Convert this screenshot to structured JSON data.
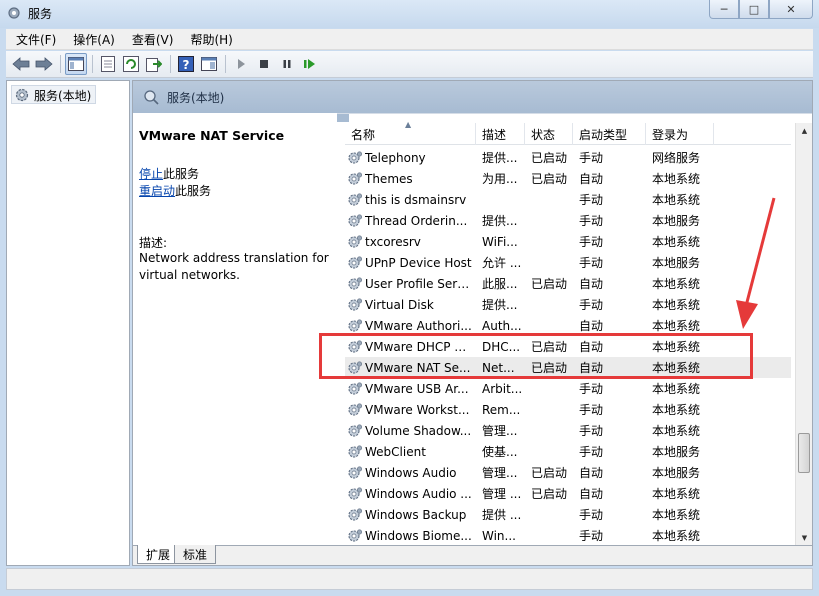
{
  "window": {
    "title": "服务",
    "buttons": {
      "minimize": "─",
      "maximize": "□",
      "close": "✕"
    }
  },
  "menu": [
    "文件(F)",
    "操作(A)",
    "查看(V)",
    "帮助(H)"
  ],
  "tree": {
    "item_label": "服务(本地)"
  },
  "main": {
    "header_label": "服务(本地)",
    "service_title": "VMware NAT Service",
    "stop_link": "停止",
    "stop_suffix": "此服务",
    "restart_link": "重启动",
    "restart_suffix": "此服务",
    "desc_label": "描述:",
    "desc_text": "Network address translation for virtual networks."
  },
  "columns": {
    "name": "名称",
    "desc": "描述",
    "status": "状态",
    "startup": "启动类型",
    "logon": "登录为"
  },
  "services": [
    {
      "name": "Telephony",
      "desc": "提供...",
      "status": "已启动",
      "startup": "手动",
      "logon": "网络服务"
    },
    {
      "name": "Themes",
      "desc": "为用...",
      "status": "已启动",
      "startup": "自动",
      "logon": "本地系统"
    },
    {
      "name": "this is dsmainsrv",
      "desc": "",
      "status": "",
      "startup": "手动",
      "logon": "本地系统"
    },
    {
      "name": "Thread Orderin...",
      "desc": "提供...",
      "status": "",
      "startup": "手动",
      "logon": "本地服务"
    },
    {
      "name": "txcoresrv",
      "desc": "WiFi...",
      "status": "",
      "startup": "手动",
      "logon": "本地系统"
    },
    {
      "name": "UPnP Device Host",
      "desc": "允许 ...",
      "status": "",
      "startup": "手动",
      "logon": "本地服务"
    },
    {
      "name": "User Profile Serv...",
      "desc": "此服...",
      "status": "已启动",
      "startup": "自动",
      "logon": "本地系统"
    },
    {
      "name": "Virtual Disk",
      "desc": "提供...",
      "status": "",
      "startup": "手动",
      "logon": "本地系统"
    },
    {
      "name": "VMware Authori...",
      "desc": "Auth...",
      "status": "",
      "startup": "自动",
      "logon": "本地系统"
    },
    {
      "name": "VMware DHCP S...",
      "desc": "DHC...",
      "status": "已启动",
      "startup": "自动",
      "logon": "本地系统"
    },
    {
      "name": "VMware NAT Se...",
      "desc": "Net...",
      "status": "已启动",
      "startup": "自动",
      "logon": "本地系统"
    },
    {
      "name": "VMware USB Ar...",
      "desc": "Arbit...",
      "status": "",
      "startup": "手动",
      "logon": "本地系统"
    },
    {
      "name": "VMware Workst...",
      "desc": "Rem...",
      "status": "",
      "startup": "手动",
      "logon": "本地系统"
    },
    {
      "name": "Volume Shadow...",
      "desc": "管理...",
      "status": "",
      "startup": "手动",
      "logon": "本地系统"
    },
    {
      "name": "WebClient",
      "desc": "使基...",
      "status": "",
      "startup": "手动",
      "logon": "本地服务"
    },
    {
      "name": "Windows Audio",
      "desc": "管理...",
      "status": "已启动",
      "startup": "自动",
      "logon": "本地服务"
    },
    {
      "name": "Windows Audio ...",
      "desc": "管理 ...",
      "status": "已启动",
      "startup": "自动",
      "logon": "本地系统"
    },
    {
      "name": "Windows Backup",
      "desc": "提供 ...",
      "status": "",
      "startup": "手动",
      "logon": "本地系统"
    },
    {
      "name": "Windows Biome...",
      "desc": "Win...",
      "status": "",
      "startup": "手动",
      "logon": "本地系统"
    }
  ],
  "selected_service": "VMware NAT Se...",
  "tabs": [
    "扩展",
    "标准"
  ],
  "accent": {
    "highlight": "#e53a3a",
    "link": "#0645ad"
  }
}
